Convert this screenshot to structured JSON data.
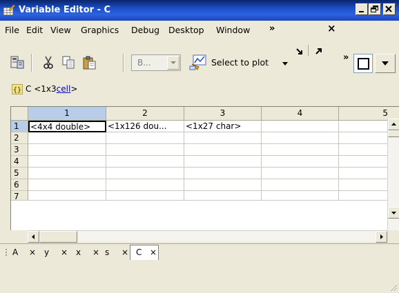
{
  "window": {
    "title": "Variable Editor - C",
    "title_bar_color": "#2d63e0",
    "controls": [
      "minimize-icon",
      "restore-icon",
      "close-icon"
    ]
  },
  "menubar": {
    "items": [
      "File",
      "Edit",
      "View",
      "Graphics",
      "Debug",
      "Desktop",
      "Window"
    ],
    "overflow": "»",
    "dock_icon": "undock-arrow-icon",
    "expand_icon": "maximize-arrow-icon",
    "close_icon": "close-icon",
    "close_label": "×"
  },
  "toolbar": {
    "buttons": [
      "import-data-icon",
      "cut-icon",
      "copy-icon",
      "paste-icon"
    ],
    "variable_combo": "B...",
    "plot_button": "Select to plot",
    "overflow": "»"
  },
  "variable": {
    "name": "C",
    "size": "<1x3",
    "type_link": "cell",
    "suffix": ">"
  },
  "grid": {
    "columns": [
      "1",
      "2",
      "3",
      "4",
      "5"
    ],
    "rows": [
      "1",
      "2",
      "3",
      "4",
      "5",
      "6",
      "7"
    ],
    "cells": [
      [
        "<4x4 double>",
        "<1x126 dou...",
        "<1x27 char>",
        "",
        ""
      ]
    ],
    "selected_column": "1",
    "selected_row": "1",
    "selection_color": "#b9cde8"
  },
  "tabs": [
    {
      "label": "A",
      "close": "×"
    },
    {
      "label": "y",
      "close": "×"
    },
    {
      "label": "x",
      "close": "×"
    },
    {
      "label": "s",
      "close": "×"
    },
    {
      "label": "C",
      "close": "×"
    }
  ],
  "active_tab": "C"
}
